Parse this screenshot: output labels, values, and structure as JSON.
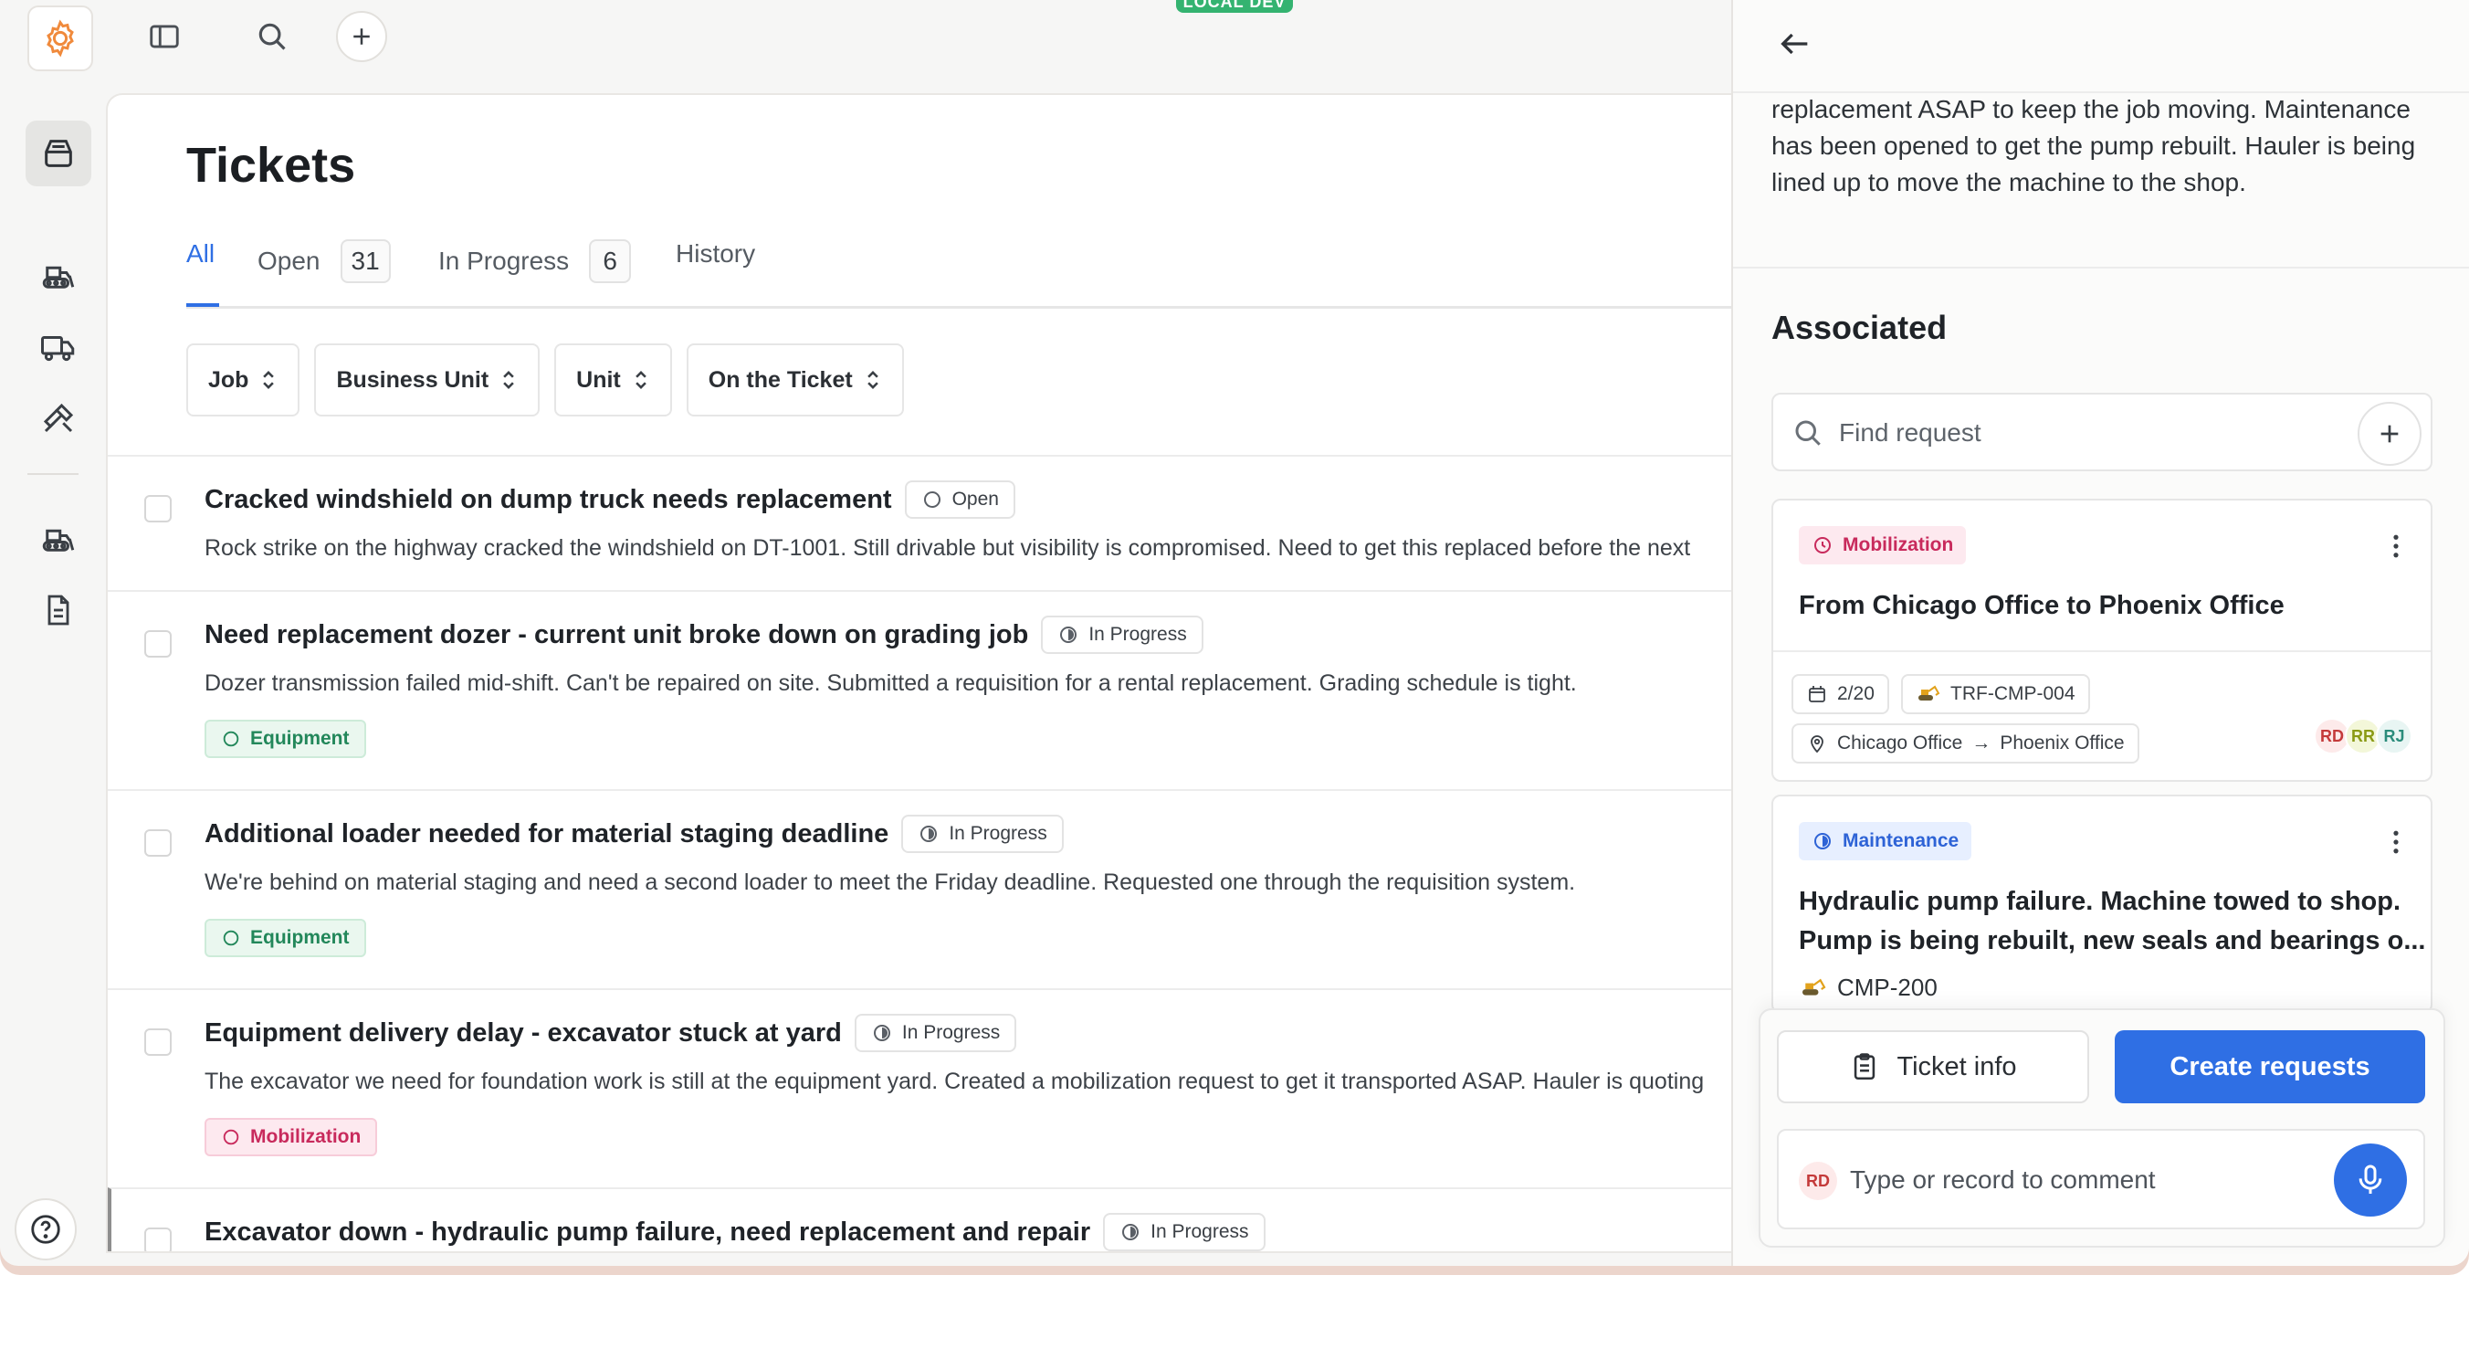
{
  "env_badge": "LOCAL DEV",
  "page": {
    "title": "Tickets",
    "tabs": [
      {
        "label": "All",
        "count": ""
      },
      {
        "label": "Open",
        "count": "31"
      },
      {
        "label": "In Progress",
        "count": "6"
      },
      {
        "label": "History",
        "count": ""
      }
    ],
    "filters": [
      "Job",
      "Business Unit",
      "Unit",
      "On the Ticket"
    ]
  },
  "tickets": [
    {
      "title": "Cracked windshield on dump truck needs replacement",
      "status": "Open",
      "description": "Rock strike on the highway cracked the windshield on DT-1001. Still drivable but visibility is compromised. Need to get this replaced before the next",
      "tag": ""
    },
    {
      "title": "Need replacement dozer - current unit broke down on grading job",
      "status": "In Progress",
      "description": "Dozer transmission failed mid-shift. Can't be repaired on site. Submitted a requisition for a rental replacement. Grading schedule is tight.",
      "tag": "Equipment"
    },
    {
      "title": "Additional loader needed for material staging deadline",
      "status": "In Progress",
      "description": "We're behind on material staging and need a second loader to meet the Friday deadline. Requested one through the requisition system.",
      "tag": "Equipment"
    },
    {
      "title": "Equipment delivery delay - excavator stuck at yard",
      "status": "In Progress",
      "description": "The excavator we need for foundation work is still at the equipment yard. Created a mobilization request to get it transported ASAP. Hauler is quoting",
      "tag": "Mobilization"
    },
    {
      "title": "Excavator down - hydraulic pump failure, need replacement and repair",
      "status": "In Progress",
      "description": "",
      "tag": ""
    }
  ],
  "side": {
    "description": "replacement ASAP to keep the job moving. Maintenance has been opened to get the pump rebuilt. Hauler is being lined up to move the machine to the shop.",
    "associated_title": "Associated",
    "find_placeholder": "Find request",
    "cards": [
      {
        "chip": "Mobilization",
        "title": "From Chicago Office to Phoenix Office",
        "date": "2/20",
        "code": "TRF-CMP-004",
        "route_from": "Chicago Office",
        "route_arrow": "→",
        "route_to": "Phoenix Office",
        "avatars": [
          "RD",
          "RR",
          "RJ"
        ]
      },
      {
        "chip": "Maintenance",
        "title_line1": "Hydraulic pump failure. Machine towed to shop.",
        "title_line2": "Pump is being rebuilt, new seals and bearings o...",
        "unit": "CMP-200"
      }
    ],
    "ticket_info_label": "Ticket info",
    "create_requests_label": "Create requests",
    "comment_avatar": "RD",
    "comment_placeholder": "Type or record to comment"
  },
  "colors": {
    "accent": "#2f6fe4",
    "equipment": "#22875a",
    "mobilization": "#c82a5c",
    "maintenance": "#2e63d6"
  }
}
